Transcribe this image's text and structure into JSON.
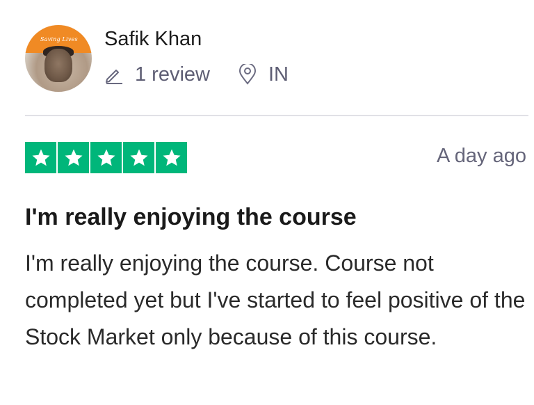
{
  "reviewer": {
    "name": "Safik Khan",
    "avatar_text": "Saving Lives",
    "review_count": "1 review",
    "country": "IN"
  },
  "review": {
    "rating": 5,
    "rating_max": 5,
    "star_color": "#00b67a",
    "date": "A day ago",
    "title": "I'm really enjoying the course",
    "body": "I'm really enjoying the course. Course not completed yet but I've started to feel positive of the Stock Market only because of this course."
  },
  "icons": {
    "review_count": "pencil-icon",
    "country": "location-pin-icon",
    "rating": "star-icon"
  }
}
